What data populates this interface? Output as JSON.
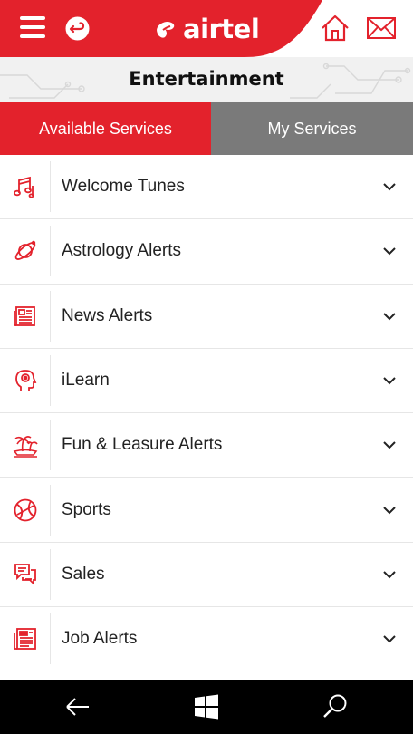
{
  "header": {
    "brand": "airtel",
    "menu_icon": "hamburger-icon",
    "back_icon": "back-arrow-circle-icon",
    "home_icon": "home-icon",
    "mail_icon": "mail-icon",
    "brand_color": "#e3222c"
  },
  "page": {
    "title": "Entertainment"
  },
  "tabs": [
    {
      "label": "Available Services",
      "active": true
    },
    {
      "label": "My Services",
      "active": false
    }
  ],
  "services": [
    {
      "label": "Welcome Tunes",
      "icon": "music-notes-icon"
    },
    {
      "label": "Astrology Alerts",
      "icon": "planet-icon"
    },
    {
      "label": "News Alerts",
      "icon": "newspaper-icon"
    },
    {
      "label": "iLearn",
      "icon": "head-brain-icon"
    },
    {
      "label": "Fun & Leasure Alerts",
      "icon": "island-palm-icon"
    },
    {
      "label": "Sports",
      "icon": "basketball-icon"
    },
    {
      "label": "Sales",
      "icon": "chat-bubbles-icon"
    },
    {
      "label": "Job Alerts",
      "icon": "job-newspaper-icon"
    }
  ],
  "navbar": {
    "back_icon": "back-arrow-icon",
    "start_icon": "windows-logo-icon",
    "search_icon": "search-icon"
  }
}
